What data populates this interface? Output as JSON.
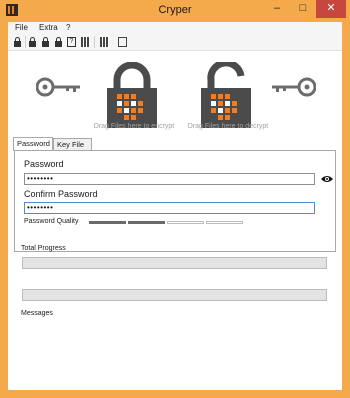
{
  "window": {
    "title": "Cryper",
    "min_glyph": "–",
    "max_glyph": "□",
    "close_glyph": "✕"
  },
  "menu": {
    "items": [
      "File",
      "Extra",
      "?"
    ]
  },
  "toolbar": {
    "icons": [
      "lock-icon",
      "lock-icon",
      "lock-icon",
      "lock-icon",
      "help-icon",
      "grid-icon",
      "grid-icon",
      "clipboard-icon"
    ]
  },
  "dropzones": {
    "encrypt_label": "Drag Files here to encrypt",
    "decrypt_label": "Drag Files here to decrypt"
  },
  "tabs": {
    "password": "Password",
    "keyfile": "Key File"
  },
  "password_form": {
    "password_label": "Password",
    "password_value": "••••••••",
    "confirm_label": "Confirm Password",
    "confirm_value": "••••••••",
    "quality_label": "Password Quality",
    "quality_level": 0.5
  },
  "progress": {
    "total_label": "Total Progress",
    "total_value": 0,
    "file_value": 0,
    "messages_label": "Messages"
  },
  "colors": {
    "accent": "#f27c1f",
    "frame": "#f4a94a",
    "lock": "#4b4b4b",
    "close": "#c7463d"
  }
}
